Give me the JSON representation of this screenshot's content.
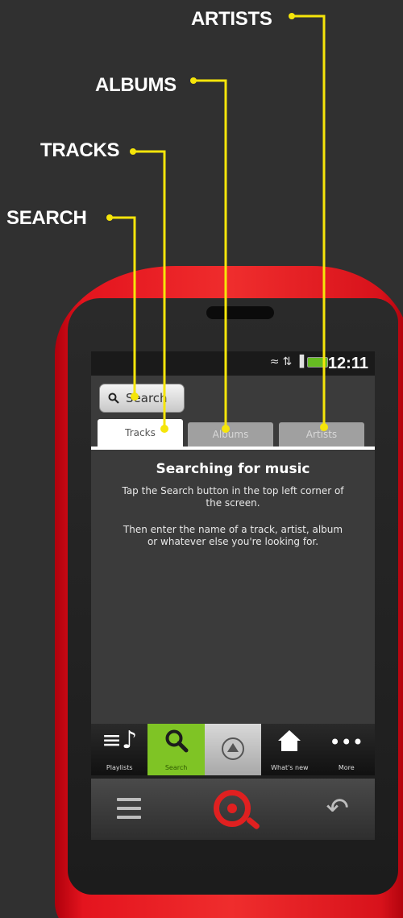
{
  "callouts": {
    "artists": "ARTISTS",
    "albums": "ALBUMS",
    "tracks": "TRACKS",
    "search": "SEARCH"
  },
  "status_bar": {
    "time": "12:11",
    "icons": [
      "wifi-icon",
      "data-icon",
      "signal-icon",
      "battery-icon"
    ]
  },
  "search_button": {
    "label": "Search",
    "icon": "search-icon"
  },
  "tabs": [
    {
      "label": "Tracks",
      "active": true
    },
    {
      "label": "Albums",
      "active": false
    },
    {
      "label": "Artists",
      "active": false
    }
  ],
  "content": {
    "heading": "Searching for music",
    "para1": "Tap the Search button in the top left corner of the screen.",
    "para2": "Then enter the name of a track, artist, album or whatever else you're looking for."
  },
  "bottom_nav": [
    {
      "label": "Playlists",
      "icon": "playlists-icon"
    },
    {
      "label": "Search",
      "icon": "search-icon",
      "active": true
    },
    {
      "label": "",
      "icon": "player-icon"
    },
    {
      "label": "What's new",
      "icon": "home-icon"
    },
    {
      "label": "More",
      "icon": "more-icon"
    }
  ],
  "colors": {
    "callout_line": "#f5e50a",
    "phone_red": "#e4141e",
    "accent_green": "#7fc425",
    "background": "#303030"
  }
}
